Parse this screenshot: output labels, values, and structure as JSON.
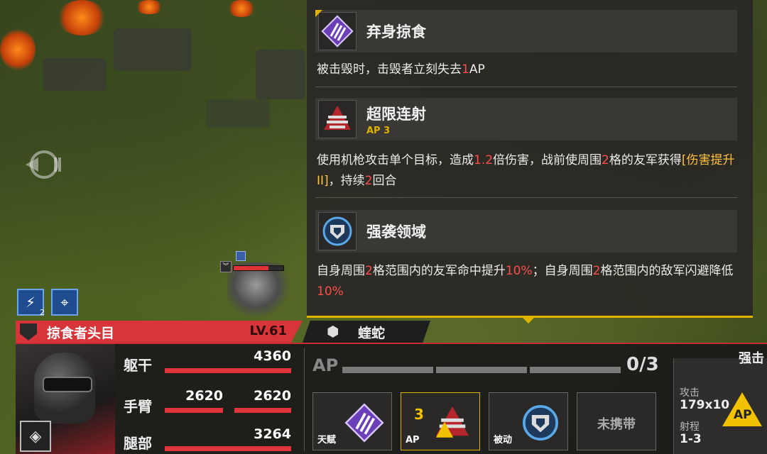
{
  "tooltip": {
    "skills": [
      {
        "name": "弃身掠食",
        "icon": "claw-icon",
        "desc_parts": [
          {
            "t": "被击毁时，击毁者立刻失去",
            "c": ""
          },
          {
            "t": "1",
            "c": "red"
          },
          {
            "t": "AP",
            "c": ""
          }
        ]
      },
      {
        "name": "超限连射",
        "icon": "bullet-volley-icon",
        "ap_label": "AP",
        "ap_value": "3",
        "desc_parts": [
          {
            "t": "使用机枪攻击单个目标，造成",
            "c": ""
          },
          {
            "t": "1.2",
            "c": "red"
          },
          {
            "t": "倍伤害，战前使周围",
            "c": ""
          },
          {
            "t": "2",
            "c": "red"
          },
          {
            "t": "格的友军获得",
            "c": ""
          },
          {
            "t": "[伤害提升 II]",
            "c": "gold"
          },
          {
            "t": "，持续",
            "c": ""
          },
          {
            "t": "2",
            "c": "red"
          },
          {
            "t": "回合",
            "c": ""
          }
        ]
      },
      {
        "name": "强袭领域",
        "icon": "shield-aura-icon",
        "desc_parts": [
          {
            "t": "自身周围",
            "c": ""
          },
          {
            "t": "2",
            "c": "red"
          },
          {
            "t": "格范围内的友军命中提升",
            "c": ""
          },
          {
            "t": "10%",
            "c": "red"
          },
          {
            "t": "；自身周围",
            "c": ""
          },
          {
            "t": "2",
            "c": "red"
          },
          {
            "t": "格范围内的敌军闪避降低",
            "c": ""
          },
          {
            "t": "10%",
            "c": "red"
          }
        ]
      }
    ]
  },
  "unit": {
    "name": "掠食者头目",
    "level": "LV.61",
    "parts": [
      {
        "label": "躯干",
        "values": [
          "4360"
        ],
        "fill": [
          1.0
        ]
      },
      {
        "label": "手臂",
        "values": [
          "2620",
          "2620"
        ],
        "fill": [
          1.0,
          1.0
        ]
      },
      {
        "label": "腿部",
        "values": [
          "3264"
        ],
        "fill": [
          1.0
        ]
      }
    ]
  },
  "enemy": {
    "name": "蝰蛇",
    "icon": "hex-emblem-icon"
  },
  "ap": {
    "label": "AP",
    "count": "0/3",
    "filled": 0,
    "total": 3
  },
  "slots": [
    {
      "label": "天赋",
      "icon": "claw-icon"
    },
    {
      "label": "AP",
      "ap_value": "3",
      "icon": "bullet-volley-icon"
    },
    {
      "label": "被动",
      "icon": "shield-aura-icon"
    },
    {
      "label": "未携带",
      "icon": ""
    }
  ],
  "attack": {
    "title": "强击",
    "atk_label": "攻击",
    "atk_value": "179x10",
    "range_label": "射程",
    "range_value": "1-3",
    "ap_badge": "AP"
  },
  "badges": [
    {
      "icon": "lightning-icon",
      "count": "2"
    },
    {
      "icon": "target-icon",
      "count": ""
    }
  ],
  "colors": {
    "accent": "#e0b300",
    "enemy_red": "#d8353a",
    "highlight_red": "#ff4d4d",
    "highlight_gold": "#ffc23d"
  }
}
